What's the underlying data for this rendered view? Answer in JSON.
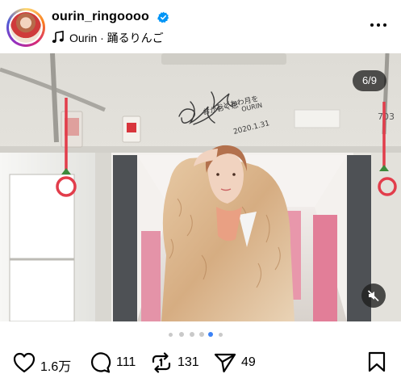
{
  "post": {
    "username": "ourin_ringoooo",
    "verified": true,
    "audio": "Ourin · 踊るりんご",
    "carousel_position": "6/9"
  },
  "photo": {
    "signature_text": [
      "おかおく思",
      "おどおわ月を",
      "OURIN",
      "2020.1.31"
    ]
  },
  "carousel": {
    "total_dots": 5,
    "active_dot_index": 3
  },
  "actions": {
    "likes": "1.6万",
    "comments": "111",
    "reposts": "131",
    "shares": "49"
  },
  "colors": {
    "accent": "#3b82f6",
    "verified_badge": "#0095f6",
    "strap_red": "#e23d4b"
  },
  "icons": [
    "verified-badge-icon",
    "music-note-icon",
    "more-options-icon",
    "mute-icon",
    "heart-icon",
    "comment-icon",
    "repost-icon",
    "share-icon",
    "bookmark-icon"
  ]
}
